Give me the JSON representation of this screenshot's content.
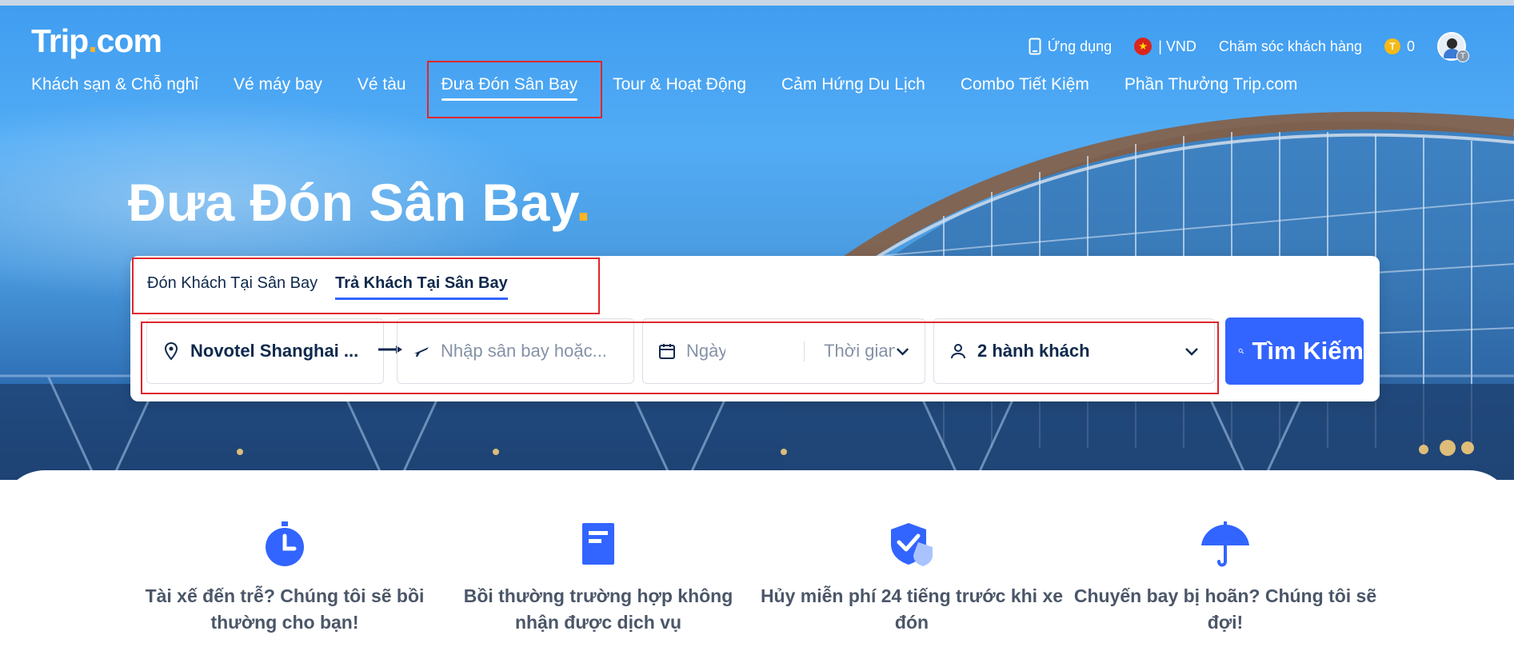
{
  "brand": {
    "logo_main": "Trip",
    "logo_dot": ".",
    "logo_suffix": "com"
  },
  "topbar": {
    "app_label": "Ứng dụng",
    "currency_label": "| VND",
    "support_label": "Chăm sóc khách hàng",
    "coins_label": "0",
    "coin_symbol": "T",
    "avatar_badge": "T"
  },
  "nav": {
    "items": [
      "Khách sạn & Chỗ nghỉ",
      "Vé máy bay",
      "Vé tàu",
      "Đưa Đón Sân Bay",
      "Tour & Hoạt Động",
      "Cảm Hứng Du Lịch",
      "Combo Tiết Kiệm",
      "Phần Thưởng Trip.com"
    ],
    "active_index": 3
  },
  "hero": {
    "title": "Đưa Đón Sân Bay",
    "title_dot": "."
  },
  "search": {
    "tabs": [
      "Đón Khách Tại Sân Bay",
      "Trả Khách Tại Sân Bay"
    ],
    "active_tab": 1,
    "from_value": "Novotel Shanghai ...",
    "to_placeholder": "Nhập sân bay hoặc...",
    "date_placeholder": "Ngày",
    "time_placeholder": "Thời gian",
    "passengers_value": "2 hành khách",
    "search_button": "Tìm Kiếm"
  },
  "features": [
    {
      "icon": "timer-icon",
      "line1": "Tài xế đến trễ? Chúng tôi sẽ bồi",
      "line2": "thường cho bạn!"
    },
    {
      "icon": "document-icon",
      "line1": "Bồi thường trường hợp không",
      "line2": "nhận được dịch vụ"
    },
    {
      "icon": "shield-check-icon",
      "line1": "Hủy miễn phí 24 tiếng trước khi xe",
      "line2": "đón"
    },
    {
      "icon": "umbrella-icon",
      "line1": "Chuyến bay bị hoãn? Chúng tôi sẽ",
      "line2": "đợi!"
    }
  ],
  "colors": {
    "primary": "#3264ff",
    "accent": "#ffb51e",
    "highlight_box": "#e0262d",
    "text_dark": "#0f294d"
  }
}
